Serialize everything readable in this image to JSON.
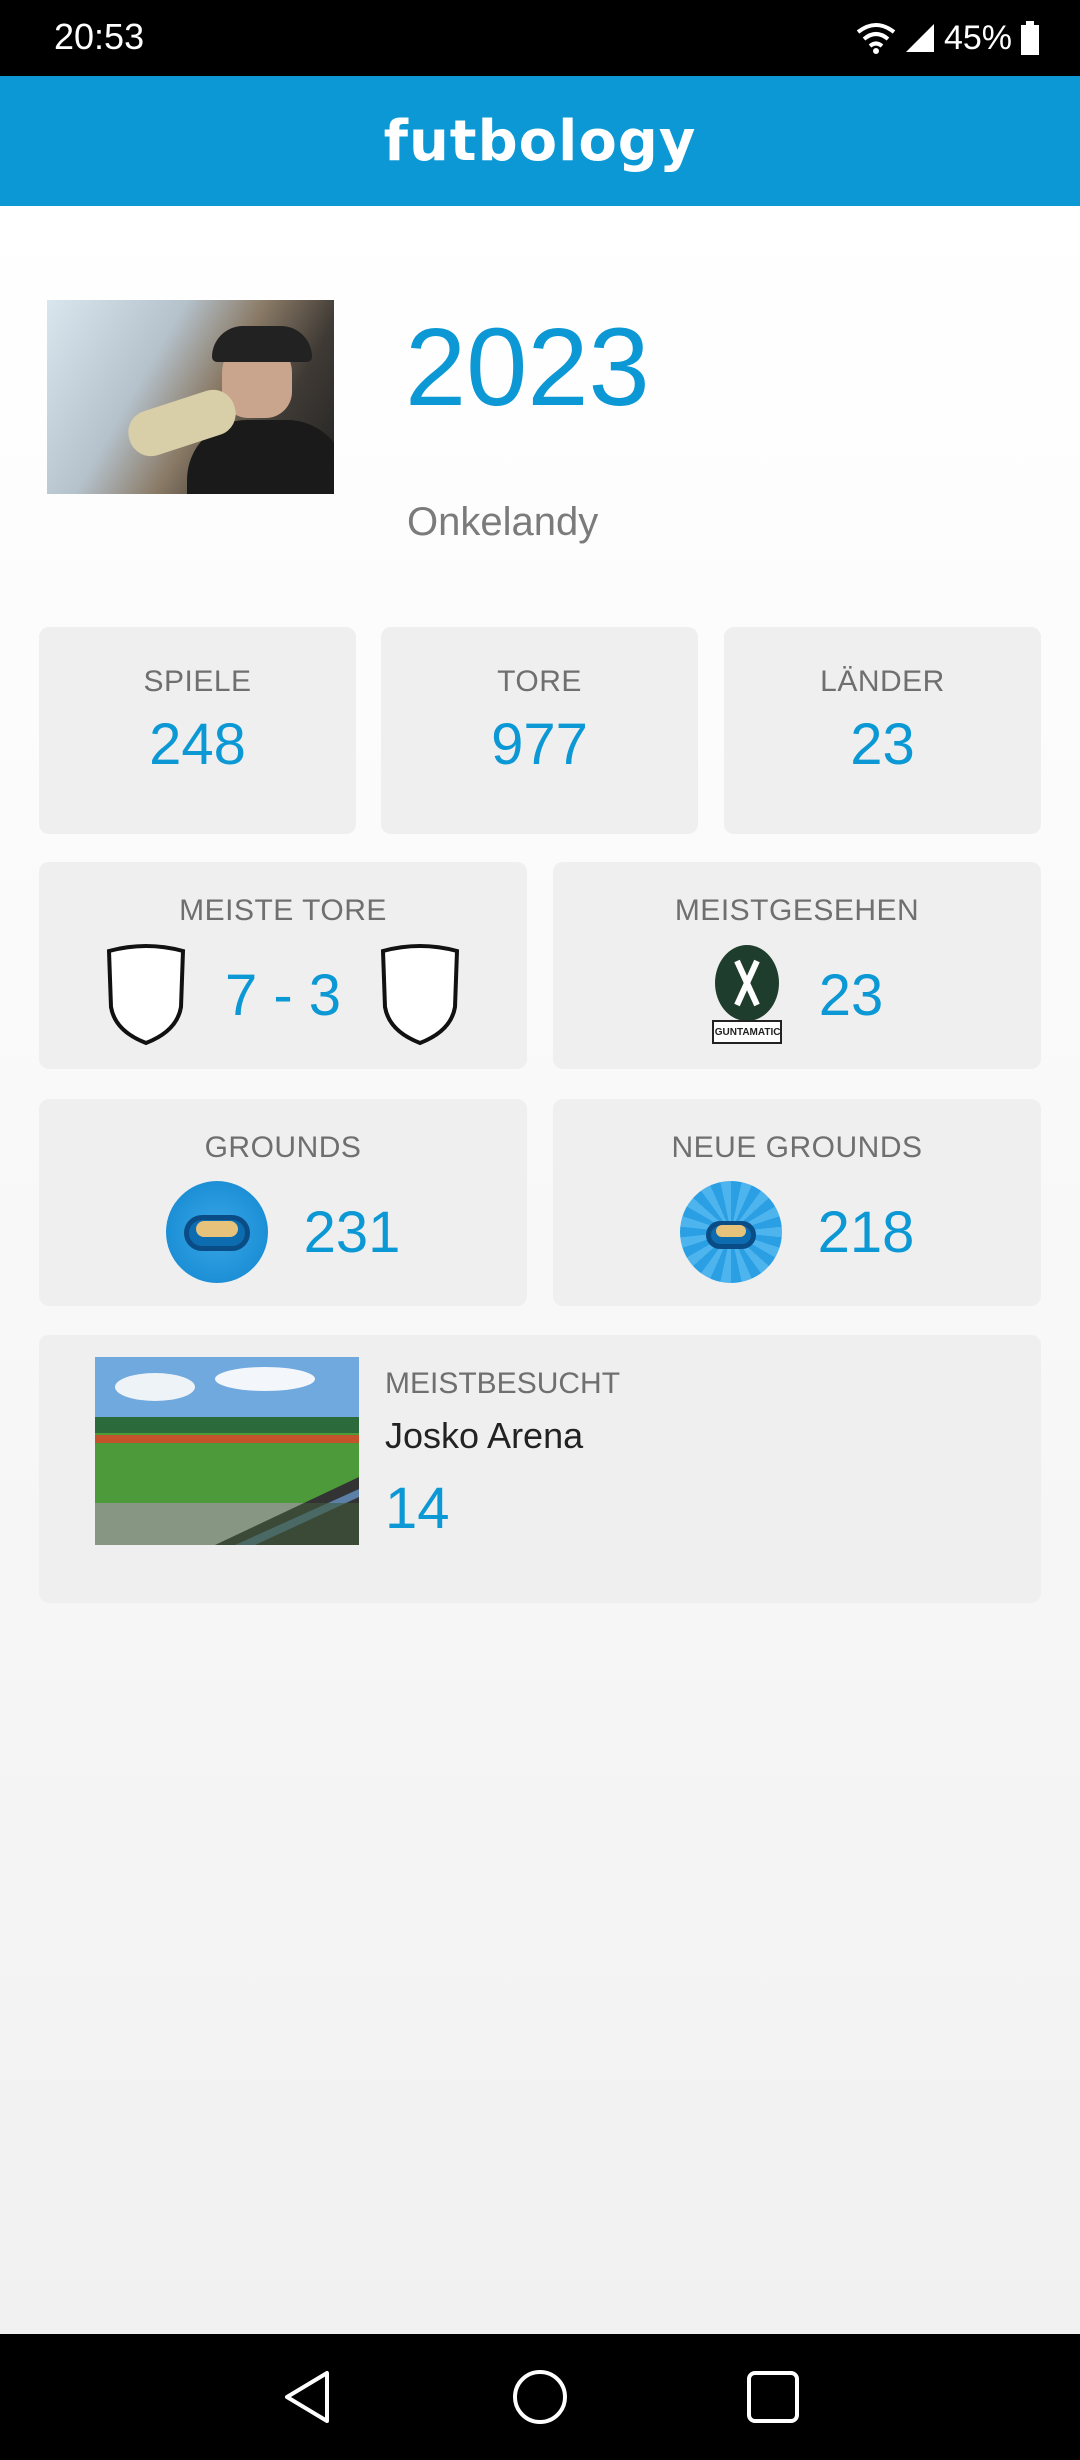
{
  "status_bar": {
    "time": "20:53",
    "battery": "45%"
  },
  "app": {
    "title": "futbology"
  },
  "profile": {
    "year": "2023",
    "username": "Onkelandy"
  },
  "stats": {
    "spiele": {
      "label": "SPIELE",
      "value": "248"
    },
    "tore": {
      "label": "TORE",
      "value": "977"
    },
    "laender": {
      "label": "LÄNDER",
      "value": "23"
    },
    "meiste_tore": {
      "label": "MEISTE TORE",
      "score": "7 - 3"
    },
    "meistgesehen": {
      "label": "MEISTGESEHEN",
      "value": "23",
      "club_logo_text": "GUNTAMATIC"
    },
    "grounds": {
      "label": "GROUNDS",
      "value": "231"
    },
    "neue_grounds": {
      "label": "NEUE GROUNDS",
      "value": "218"
    }
  },
  "most_visited": {
    "label": "MEISTBESUCHT",
    "venue": "Josko Arena",
    "count": "14"
  },
  "icons": {
    "shield": "shield-outline-icon",
    "stadium": "stadium-icon",
    "back": "back-triangle-icon",
    "home": "home-circle-icon",
    "recents": "recents-square-icon"
  },
  "colors": {
    "accent": "#0b98d4",
    "card": "#efefef",
    "label": "#6f6f6f"
  }
}
